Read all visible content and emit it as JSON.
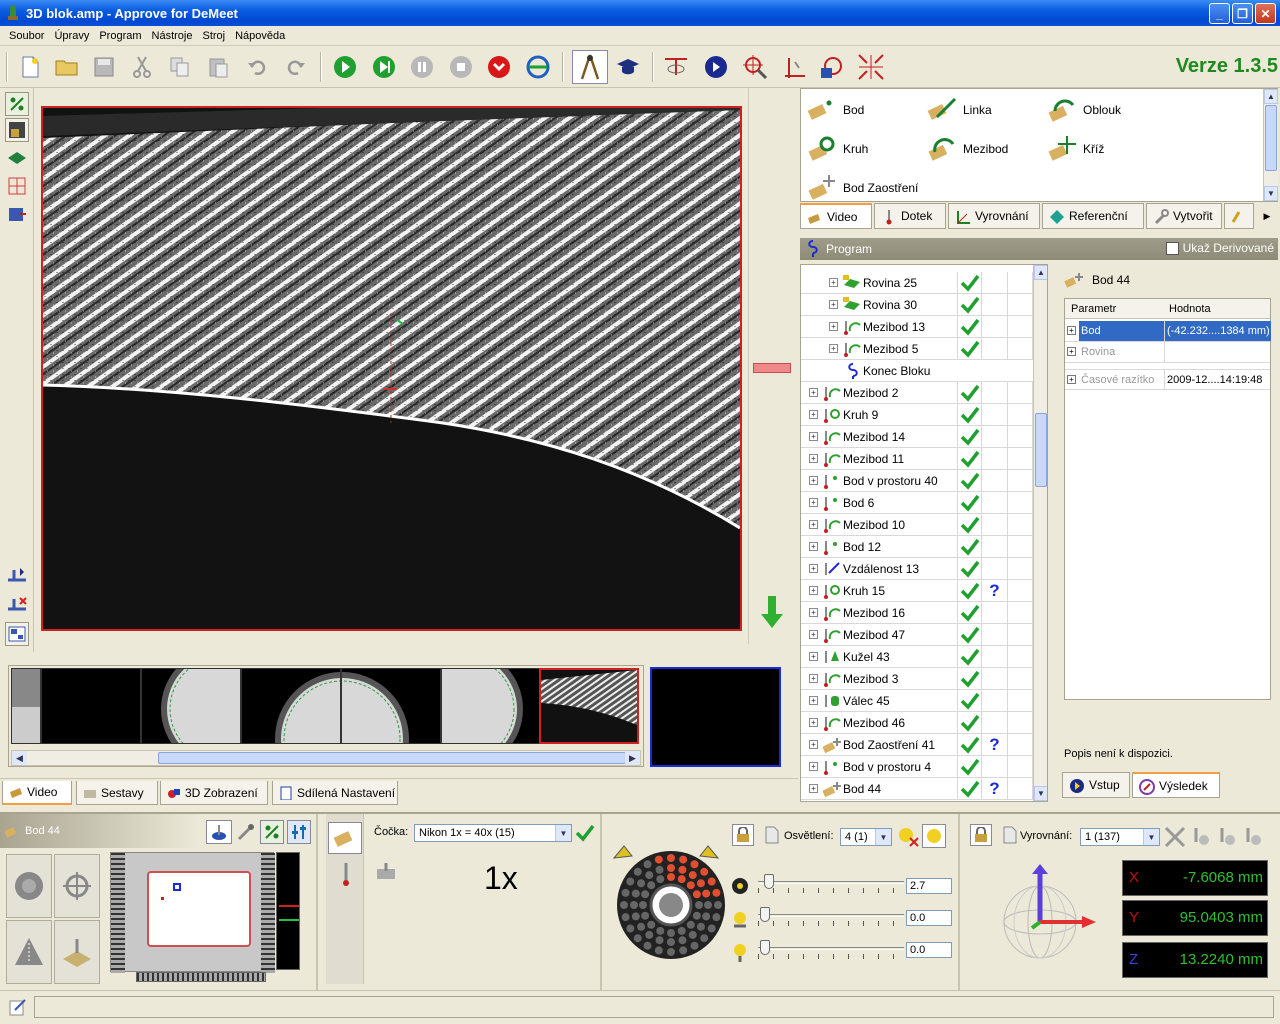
{
  "window": {
    "title": "3D blok.amp - Approve for DeMeet",
    "buttons": {
      "minimize": "_",
      "maximize": "❐",
      "close": "✕"
    }
  },
  "menu": [
    "Soubor",
    "Úpravy",
    "Program",
    "Nástroje",
    "Stroj",
    "Nápověda"
  ],
  "version": "Verze 1.3.5",
  "palette": {
    "items": [
      {
        "label": "Bod",
        "icon": "point-icon"
      },
      {
        "label": "Linka",
        "icon": "line-icon"
      },
      {
        "label": "Oblouk",
        "icon": "arc-icon"
      },
      {
        "label": "Kruh",
        "icon": "circle-icon"
      },
      {
        "label": "Mezibod",
        "icon": "midpoint-icon"
      },
      {
        "label": "Kříž",
        "icon": "cross-icon"
      },
      {
        "label": "Bod Zaostření",
        "icon": "focus-point-icon"
      }
    ]
  },
  "feature_tabs": [
    "Video",
    "Dotek",
    "Vyrovnání",
    "Referenční",
    "Vytvořit"
  ],
  "program": {
    "header": "Program",
    "show_derived": "Ukaž Derivované",
    "rows": [
      {
        "label": "Rovina 25",
        "icon": "plane",
        "level": 1,
        "status": "ok",
        "q": ""
      },
      {
        "label": "Rovina 30",
        "icon": "plane",
        "level": 1,
        "status": "ok",
        "q": ""
      },
      {
        "label": "Mezibod 13",
        "icon": "mid",
        "level": 1,
        "status": "ok",
        "q": ""
      },
      {
        "label": "Mezibod 5",
        "icon": "mid",
        "level": 1,
        "status": "ok",
        "q": ""
      },
      {
        "label": "Konec Bloku",
        "icon": "end",
        "level": 1,
        "status": "",
        "q": ""
      },
      {
        "label": "Mezibod 2",
        "icon": "mid",
        "level": 0,
        "status": "ok",
        "q": ""
      },
      {
        "label": "Kruh 9",
        "icon": "circle",
        "level": 0,
        "status": "ok",
        "q": ""
      },
      {
        "label": "Mezibod 14",
        "icon": "mid",
        "level": 0,
        "status": "ok",
        "q": ""
      },
      {
        "label": "Mezibod 11",
        "icon": "mid",
        "level": 0,
        "status": "ok",
        "q": ""
      },
      {
        "label": "Bod v prostoru 40",
        "icon": "point3d",
        "level": 0,
        "status": "ok",
        "q": ""
      },
      {
        "label": "Bod 6",
        "icon": "point3d",
        "level": 0,
        "status": "ok",
        "q": ""
      },
      {
        "label": "Mezibod 10",
        "icon": "mid",
        "level": 0,
        "status": "ok",
        "q": ""
      },
      {
        "label": "Bod 12",
        "icon": "point3d",
        "level": 0,
        "status": "ok",
        "q": ""
      },
      {
        "label": "Vzdálenost 13",
        "icon": "distance",
        "level": 0,
        "status": "ok",
        "q": ""
      },
      {
        "label": "Kruh 15",
        "icon": "circle",
        "level": 0,
        "status": "ok",
        "q": "?"
      },
      {
        "label": "Mezibod 16",
        "icon": "mid",
        "level": 0,
        "status": "ok",
        "q": ""
      },
      {
        "label": "Mezibod 47",
        "icon": "mid",
        "level": 0,
        "status": "ok",
        "q": ""
      },
      {
        "label": "Kužel 43",
        "icon": "cone",
        "level": 0,
        "status": "ok",
        "q": ""
      },
      {
        "label": "Mezibod 3",
        "icon": "mid",
        "level": 0,
        "status": "ok",
        "q": ""
      },
      {
        "label": "Válec 45",
        "icon": "cylinder",
        "level": 0,
        "status": "ok",
        "q": ""
      },
      {
        "label": "Mezibod 46",
        "icon": "mid",
        "level": 0,
        "status": "ok",
        "q": ""
      },
      {
        "label": "Bod Zaostření 41",
        "icon": "focus",
        "level": 0,
        "status": "ok",
        "q": "?"
      },
      {
        "label": "Bod v prostoru 4",
        "icon": "point3d",
        "level": 0,
        "status": "ok",
        "q": ""
      },
      {
        "label": "Bod 44",
        "icon": "focus",
        "level": 0,
        "status": "ok",
        "q": "?"
      }
    ]
  },
  "detail": {
    "title": "Bod 44",
    "col_param": "Parametr",
    "col_value": "Hodnota",
    "rows": [
      {
        "name": "Bod",
        "value": "(-42.232....1384 mm)"
      },
      {
        "name": "Rovina",
        "value": ""
      },
      {
        "name": "Časové razítko",
        "value": "2009-12....14:19:48"
      }
    ],
    "description": "Popis není k dispozici.",
    "tabs": [
      "Vstup",
      "Výsledek"
    ]
  },
  "bottom_tabs": [
    "Video",
    "Sestavy",
    "3D Zobrazení",
    "Sdílená Nastavení"
  ],
  "controls": {
    "feature_name": "Bod 44",
    "lens_label": "Čočka:",
    "lens_value": "Nikon 1x = 40x (15)",
    "zoom": "1x",
    "light_label": "Osvětlení:",
    "light_value": "4 (1)",
    "lights": [
      {
        "value": "2.7",
        "level": 0.03
      },
      {
        "value": "0.0",
        "level": 0.0
      },
      {
        "value": "0.0",
        "level": 0.0
      }
    ],
    "align_label": "Vyrovnání:",
    "align_value": "1 (137)",
    "coords": [
      {
        "axis": "X",
        "value": "-7.6068 mm"
      },
      {
        "axis": "Y",
        "value": "95.0403 mm"
      },
      {
        "axis": "Z",
        "value": "13.2240 mm"
      }
    ]
  },
  "colors": {
    "accent_green": "#1e8a1e",
    "selection": "#316ac5",
    "frame_red": "#d02020"
  }
}
